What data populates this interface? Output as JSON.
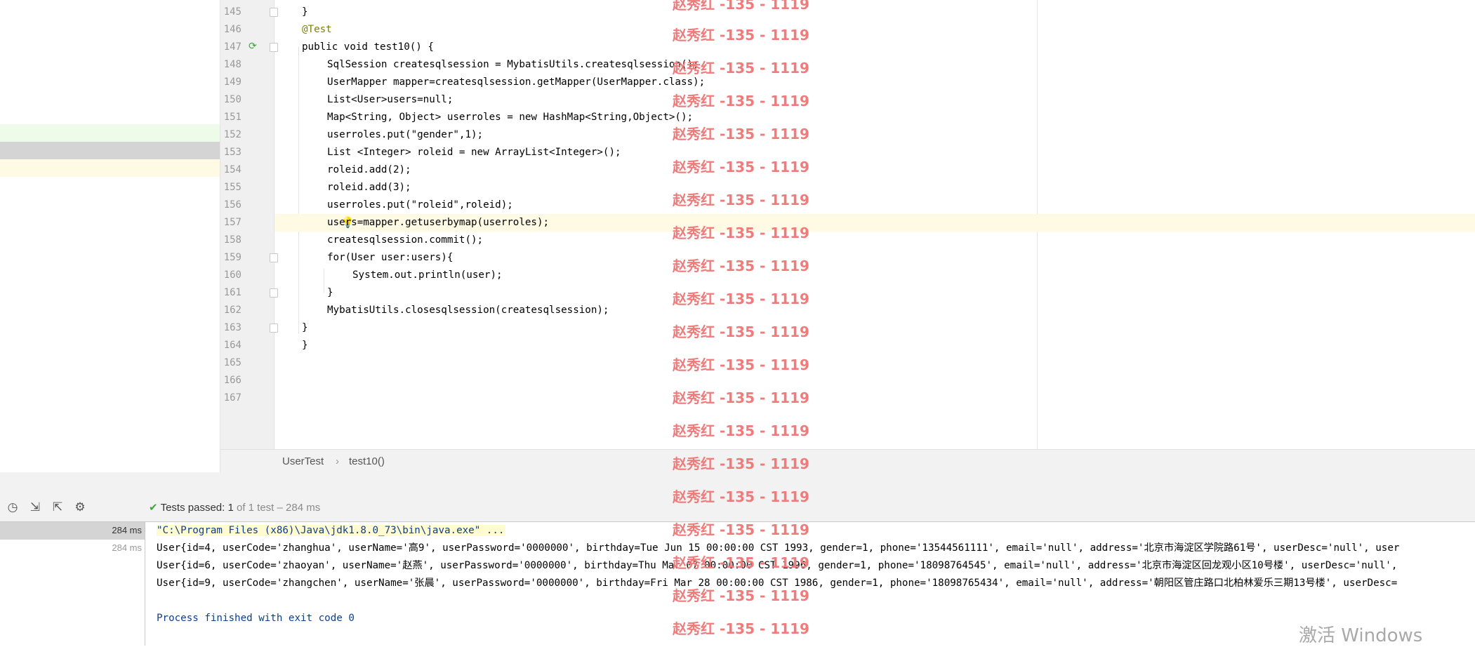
{
  "editor": {
    "lines": [
      {
        "n": "145",
        "text": "}"
      },
      {
        "n": "146",
        "text": "@Test"
      },
      {
        "n": "147",
        "text": "public void test10() {"
      },
      {
        "n": "148",
        "text": "SqlSession createsqlsession = MybatisUtils.createsqlsession();"
      },
      {
        "n": "149",
        "text": "UserMapper mapper=createsqlsession.getMapper(UserMapper.class);"
      },
      {
        "n": "150",
        "text": "List<User>users=null;"
      },
      {
        "n": "151",
        "text": "Map<String, Object> userroles = new HashMap<String,Object>();"
      },
      {
        "n": "152",
        "text": "userroles.put(\"gender\",1);"
      },
      {
        "n": "153",
        "text": "List <Integer> roleid = new ArrayList<Integer>();"
      },
      {
        "n": "154",
        "text": "roleid.add(2);"
      },
      {
        "n": "155",
        "text": "roleid.add(3);"
      },
      {
        "n": "156",
        "text": "userroles.put(\"roleid\",roleid);"
      },
      {
        "n": "157",
        "text": "users=mapper.getuserbymap(userroles);"
      },
      {
        "n": "158",
        "text": "createsqlsession.commit();"
      },
      {
        "n": "159",
        "text": "for(User user:users){"
      },
      {
        "n": "160",
        "text": "System.out.println(user);"
      },
      {
        "n": "161",
        "text": "}"
      },
      {
        "n": "162",
        "text": "MybatisUtils.closesqlsession(createsqlsession);"
      },
      {
        "n": "163",
        "text": "}"
      },
      {
        "n": "164",
        "text": "}"
      },
      {
        "n": "165",
        "text": ""
      },
      {
        "n": "166",
        "text": ""
      },
      {
        "n": "167",
        "text": ""
      }
    ],
    "icons": {
      "run_line": "run-test-icon",
      "intention": "lightbulb-icon",
      "fold": "fold-marker-icon"
    }
  },
  "breadcrumb": {
    "class_name": "UserTest",
    "separator": "›",
    "method_name": "test10()"
  },
  "run_panel": {
    "toolbar_icons": [
      "history-icon",
      "import-tests-icon",
      "export-tests-icon",
      "settings-icon"
    ],
    "status": {
      "prefix": "Tests passed:",
      "passed": "1",
      "rest": "of 1 test – 284 ms"
    },
    "tree": [
      {
        "time": "284 ms"
      },
      {
        "time": "284 ms"
      }
    ],
    "console": {
      "command": "\"C:\\Program Files (x86)\\Java\\jdk1.8.0_73\\bin\\java.exe\" ...",
      "output": [
        "User{id=4, userCode='zhanghua', userName='高9', userPassword='0000000', birthday=Tue Jun 15 00:00:00 CST 1993, gender=1, phone='13544561111', email='null', address='北京市海淀区学院路61号', userDesc='null', user",
        "User{id=6, userCode='zhaoyan', userName='赵燕', userPassword='0000000', birthday=Thu Mar 07 00:00:00 CST 1996, gender=1, phone='18098764545', email='null', address='北京市海淀区回龙观小区10号楼', userDesc='null',",
        "User{id=9, userCode='zhangchen', userName='张晨', userPassword='0000000', birthday=Fri Mar 28 00:00:00 CST 1986, gender=1, phone='18098765434', email='null', address='朝阳区管庄路口北柏林爱乐三期13号楼', userDesc="
      ],
      "exit": "Process finished with exit code 0"
    }
  },
  "watermark": {
    "text": "赵秀红 -135 - 1119",
    "color": "#f07b7b"
  },
  "os_overlay": {
    "text": "激活 Windows"
  },
  "colors": {
    "gutter": "#f0f0f0",
    "current_line": "#fffae3",
    "tree_selected": "#d4d4d4",
    "pass_green": "#3fa23f",
    "keyword": "#000080",
    "string": "#008000"
  }
}
